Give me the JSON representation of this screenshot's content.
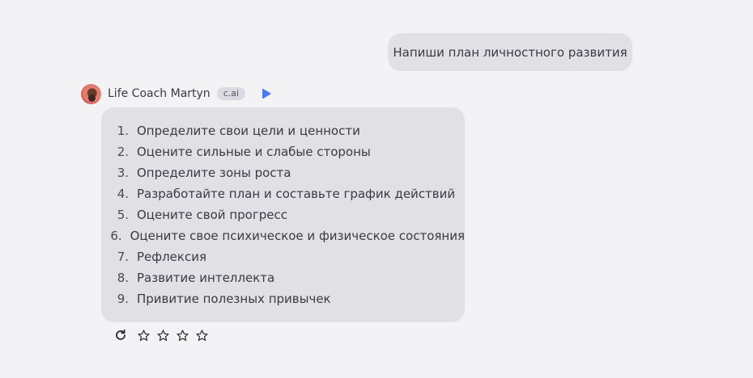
{
  "user_message": {
    "text": "Напиши план личностного развития"
  },
  "character": {
    "name": "Life Coach Martyn",
    "badge": "c.ai",
    "icons": {
      "avatar": "avatar",
      "play": "play-icon"
    },
    "accent_color": "#4a7cf0"
  },
  "bot_message": {
    "items": [
      {
        "num": "1.",
        "text": "Определите свои цели и ценности"
      },
      {
        "num": "2.",
        "text": "Оцените сильные и слабые стороны"
      },
      {
        "num": "3.",
        "text": "Определите зоны роста"
      },
      {
        "num": "4.",
        "text": "Разработайте план и составьте график действий"
      },
      {
        "num": "5.",
        "text": "Оцените свой прогресс"
      },
      {
        "num": "6.",
        "text": "Оцените свое психическое и физическое состояния"
      },
      {
        "num": "7.",
        "text": "Рефлексия"
      },
      {
        "num": "8.",
        "text": "Развитие интеллекта"
      },
      {
        "num": "9.",
        "text": "Привитие полезных привычек"
      }
    ]
  },
  "actions": {
    "icons": [
      "refresh-icon",
      "star-icon"
    ],
    "rating": {
      "value": 0,
      "max": 4
    }
  }
}
